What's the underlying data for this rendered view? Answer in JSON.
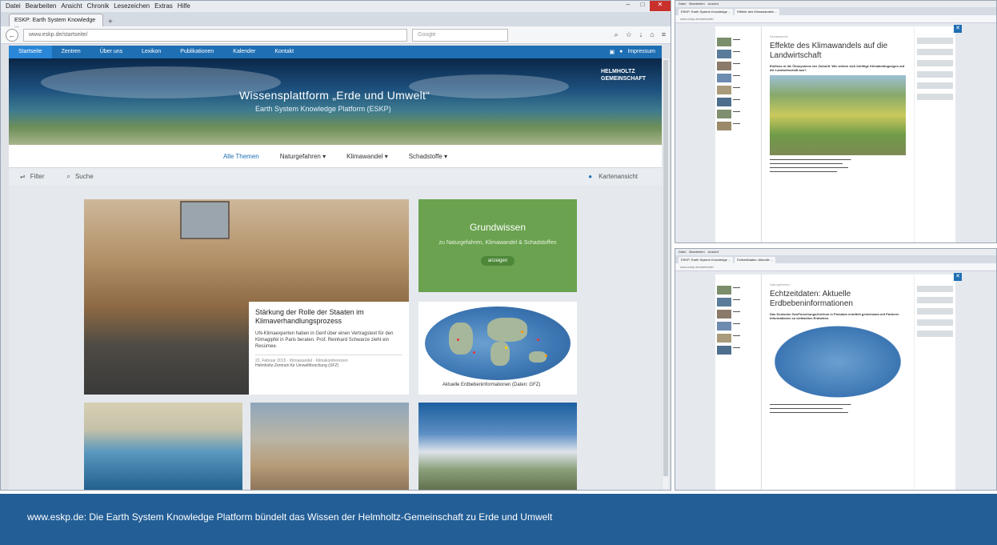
{
  "main_window": {
    "menu": [
      "Datei",
      "Bearbeiten",
      "Ansicht",
      "Chronik",
      "Lesezeichen",
      "Extras",
      "Hilfe"
    ],
    "tab_title": "ESKP: Earth System Knowledge ...",
    "url": "www.eskp.de/startseite/",
    "search_placeholder": "Google",
    "site_nav": [
      "Startseite",
      "Zentren",
      "Über uns",
      "Lexikon",
      "Publikationen",
      "Kalender",
      "Kontakt"
    ],
    "site_nav_right": "Impressum",
    "hero_title": "Wissensplattform „Erde und Umwelt“",
    "hero_subtitle": "Earth System Knowledge Platform (ESKP)",
    "logo_line1": "HELMHOLTZ",
    "logo_line2": "GEMEINSCHAFT",
    "filters": [
      "Alle Themen",
      "Naturgefahren ▾",
      "Klimawandel ▾",
      "Schadstoffe ▾"
    ],
    "tool_filter": "Filter",
    "tool_search": "Suche",
    "tool_map": "Kartenansicht",
    "feature": {
      "title": "Stärkung der Rolle der Staaten im Klimaverhandlungsprozess",
      "desc": "UN-Klimaexperten haben in Genf über einen Vertragstext für den Klimagipfel in Paris beraten. Prof. Reinhard Schwarze zieht ein Resümee.",
      "meta": "22. Februar 2015 · Klimawandel · Klimakonferenzen",
      "source": "Helmholtz-Zentrum für Umweltforschung (UFZ)"
    },
    "grundwissen": {
      "title": "Grundwissen",
      "desc": "zu Naturgefahren, Klimawandel & Schadstoffen",
      "button": "anzeigen"
    },
    "map_caption": "Aktuelle Erdbebeninformationen (Daten: GFZ)"
  },
  "side_top": {
    "tabs": [
      "ESKP: Earth System Knowledge ...",
      "Effekte des Klimawandels ..."
    ],
    "kicker": "Klimawandel",
    "title": "Effekte des Klimawandels auf die Landwirtschaft",
    "lead": "Einfluss in die Ökosysteme der Zukunft. Wie wirken sich künftige Klimabedingungen auf die Landwirtschaft aus?"
  },
  "side_bottom": {
    "tabs": [
      "ESKP: Earth System Knowledge ...",
      "Echtzeitdaten: Aktuelle ..."
    ],
    "kicker": "Naturgefahren",
    "title": "Echtzeitdaten: Aktuelle Erdbebeninformationen",
    "lead": "Das Deutsche GeoForschungsZentrum in Potsdam ermittelt gemeinsam mit Partnern Informationen zu weltweiten Erdbeben."
  },
  "caption": "www.eskp.de: Die Earth System Knowledge Platform bündelt das Wissen der Helmholtz-Gemeinschaft zu Erde und Umwelt",
  "colors": {
    "nav_blue": "#1f6fb4",
    "grundwissen_green": "#6aa24f",
    "caption_bg": "#235e96"
  }
}
